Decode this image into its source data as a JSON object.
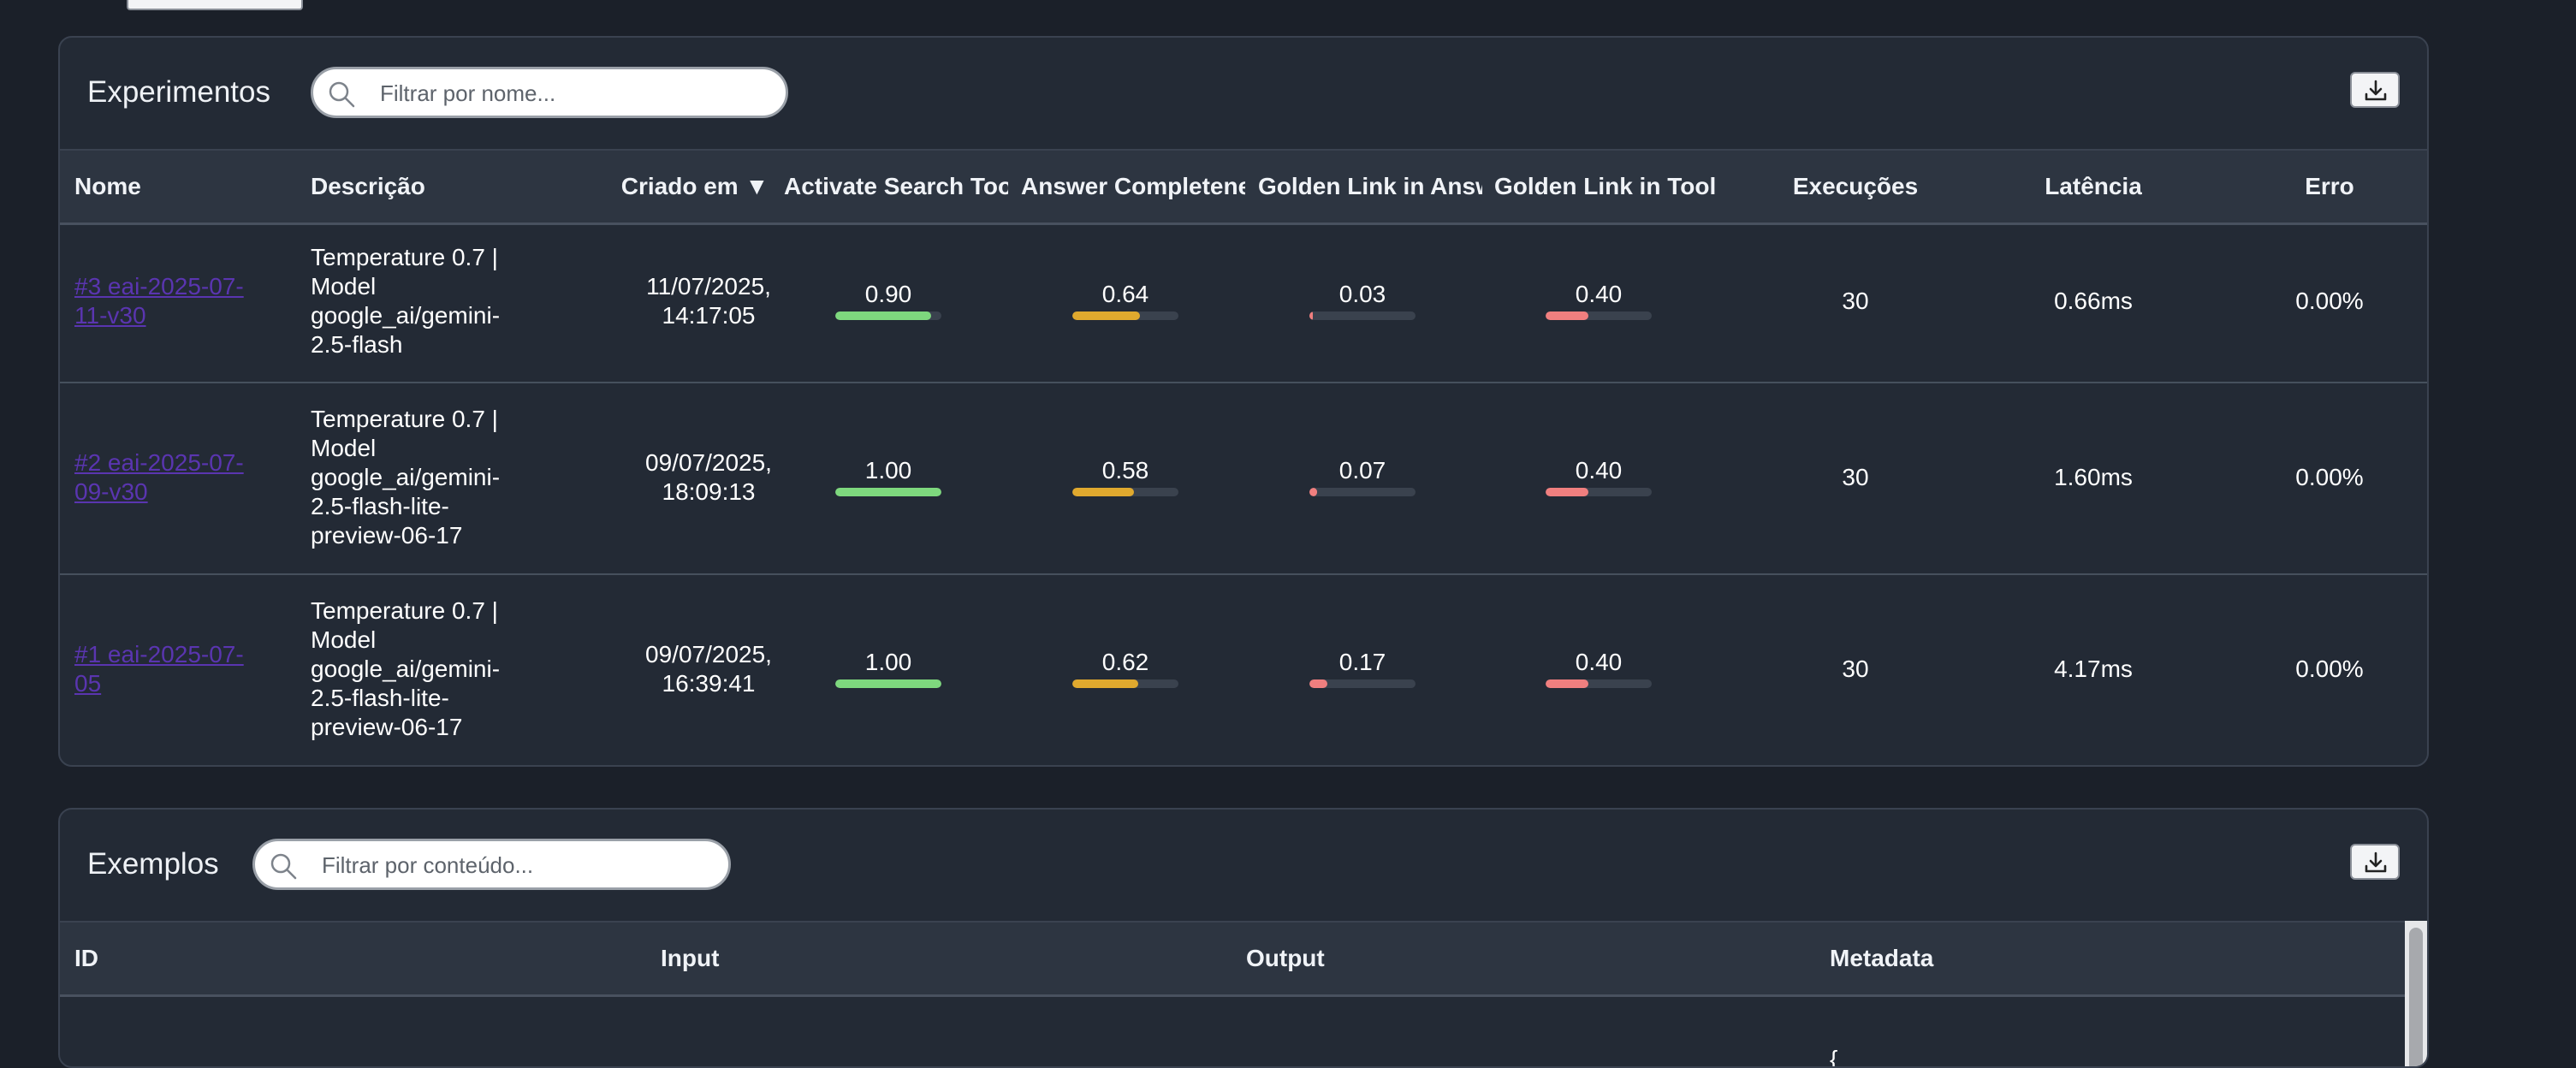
{
  "experiments": {
    "title": "Experimentos",
    "search_placeholder": "Filtrar por nome...",
    "columns": [
      "Nome",
      "Descrição",
      "Criado em ▼",
      "Activate Search Tool",
      "Answer Completeness",
      "Golden Link in Answer",
      "Golden Link in Tool Calls",
      "Execuções",
      "Latência",
      "Erro"
    ],
    "rows": [
      {
        "name_lines": [
          "#3 eai-2025-07-",
          "11-v30"
        ],
        "desc_lines": [
          "Temperature 0.7 |",
          "Model",
          "google_ai/gemini-",
          "2.5-flash"
        ],
        "date_lines": [
          "11/07/2025,",
          "14:17:05"
        ],
        "metrics": [
          {
            "label": "0.90",
            "value": 0.9
          },
          {
            "label": "0.64",
            "value": 0.64
          },
          {
            "label": "0.03",
            "value": 0.03
          },
          {
            "label": "0.40",
            "value": 0.4
          }
        ],
        "execucoes": "30",
        "latencia": "0.66ms",
        "erro": "0.00%"
      },
      {
        "name_lines": [
          "#2 eai-2025-07-",
          "09-v30"
        ],
        "desc_lines": [
          "Temperature 0.7 |",
          "Model",
          "google_ai/gemini-",
          "2.5-flash-lite-",
          "preview-06-17"
        ],
        "date_lines": [
          "09/07/2025,",
          "18:09:13"
        ],
        "metrics": [
          {
            "label": "1.00",
            "value": 1.0
          },
          {
            "label": "0.58",
            "value": 0.58
          },
          {
            "label": "0.07",
            "value": 0.07
          },
          {
            "label": "0.40",
            "value": 0.4
          }
        ],
        "execucoes": "30",
        "latencia": "1.60ms",
        "erro": "0.00%"
      },
      {
        "name_lines": [
          "#1 eai-2025-07-",
          "05"
        ],
        "desc_lines": [
          "Temperature 0.7 |",
          "Model",
          "google_ai/gemini-",
          "2.5-flash-lite-",
          "preview-06-17"
        ],
        "date_lines": [
          "09/07/2025,",
          "16:39:41"
        ],
        "metrics": [
          {
            "label": "1.00",
            "value": 1.0
          },
          {
            "label": "0.62",
            "value": 0.62
          },
          {
            "label": "0.17",
            "value": 0.17
          },
          {
            "label": "0.40",
            "value": 0.4
          }
        ],
        "execucoes": "30",
        "latencia": "4.17ms",
        "erro": "0.00%"
      }
    ]
  },
  "examples": {
    "title": "Exemplos",
    "search_placeholder": "Filtrar por conteúdo...",
    "columns": [
      "ID",
      "Input",
      "Output",
      "Metadata"
    ],
    "metadata_preview": "{"
  },
  "metric_colors": [
    "#7ed87e",
    "#e0a92e",
    "#f07f7f",
    "#f07f7f"
  ],
  "icons": {
    "search": "search-icon",
    "download": "download-icon"
  }
}
